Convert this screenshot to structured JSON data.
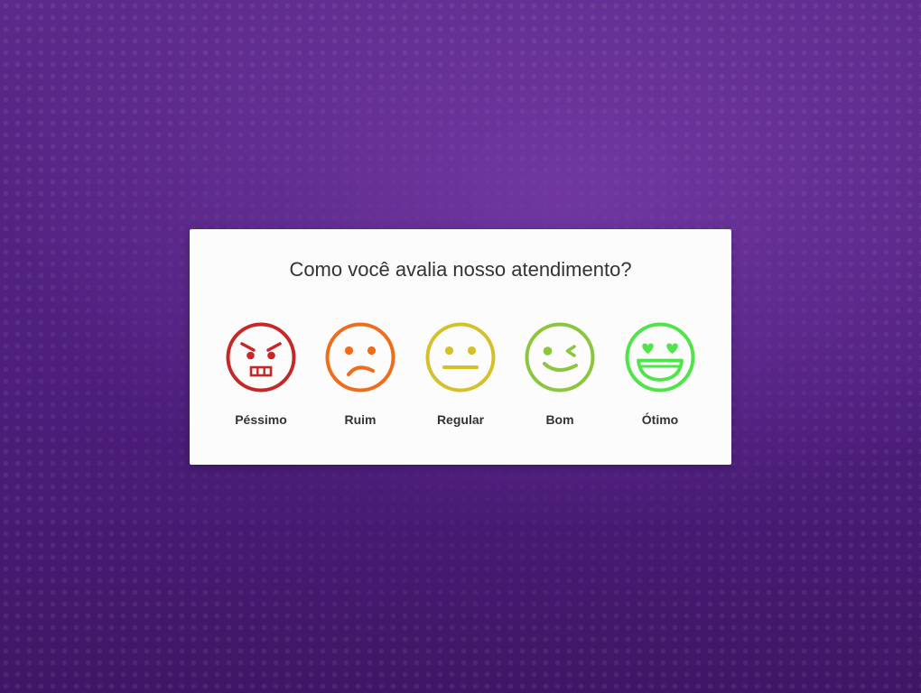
{
  "survey": {
    "question": "Como você avalia nosso atendimento?",
    "options": [
      {
        "label": "Péssimo",
        "icon": "angry-face-icon",
        "color": "#c62828"
      },
      {
        "label": "Ruim",
        "icon": "sad-face-icon",
        "color": "#ef6c1a"
      },
      {
        "label": "Regular",
        "icon": "neutral-face-icon",
        "color": "#d4c12a"
      },
      {
        "label": "Bom",
        "icon": "winking-face-icon",
        "color": "#8cc63e"
      },
      {
        "label": "Ótimo",
        "icon": "heart-eyes-face-icon",
        "color": "#4ee44a"
      }
    ]
  },
  "theme": {
    "background": "#4e1f7c",
    "card_background": "#fcfcfc",
    "text_color": "#333333"
  }
}
